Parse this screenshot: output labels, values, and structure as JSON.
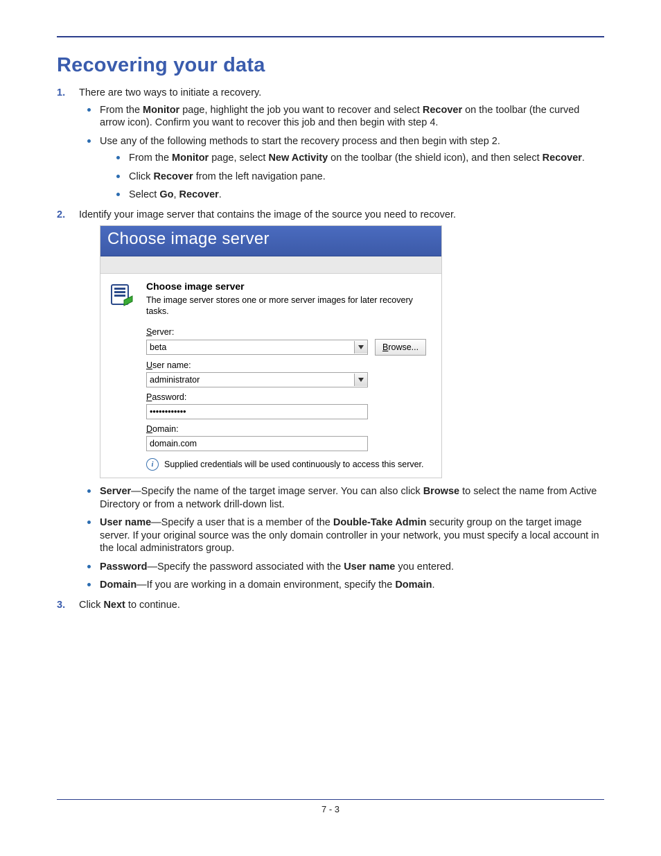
{
  "heading": "Recovering your data",
  "steps": {
    "s1": {
      "text": "There are two ways to initiate a recovery.",
      "bullets": {
        "b1": {
          "pre": "From the ",
          "bold1": "Monitor",
          "mid": " page, highlight the job you want to recover and select ",
          "bold2": "Recover",
          "post": " on the toolbar (the curved arrow icon). Confirm you want to recover this job and then begin with step 4."
        },
        "b2": {
          "text": "Use any of the following methods to start the recovery process and then begin with step 2.",
          "sub": {
            "s1": {
              "pre": "From the ",
              "bold1": "Monitor",
              "mid": " page, select ",
              "bold2": "New Activity",
              "mid2": " on the toolbar (the shield icon), and then select ",
              "bold3": "Recover",
              "post": "."
            },
            "s2": {
              "pre": "Click ",
              "bold1": "Recover",
              "post": " from the left navigation pane."
            },
            "s3": {
              "pre": "Select ",
              "bold1": "Go",
              "mid": ", ",
              "bold2": "Recover",
              "post": "."
            }
          }
        }
      }
    },
    "s2": {
      "text": "Identify your image server that contains the image of the source you need to recover."
    },
    "s3": {
      "pre": "Click ",
      "bold1": "Next",
      "post": " to continue."
    }
  },
  "dialog": {
    "title": "Choose image server",
    "header": "Choose image server",
    "subtitle": "The image server stores one or more server images for later recovery tasks.",
    "labels": {
      "server": "Server:",
      "user": "User name:",
      "pass": "Password:",
      "domain": "Domain:"
    },
    "underline": {
      "server": "S",
      "user": "U",
      "pass": "P",
      "domain": "D",
      "browse": "B"
    },
    "values": {
      "server": "beta",
      "user": "administrator",
      "pass": "••••••••••••",
      "domain": "domain.com"
    },
    "browse": "rowse...",
    "info": "Supplied credentials will be used continuously to access this server."
  },
  "fields": {
    "server": {
      "bold": "Server",
      "text": "—Specify the name of the target image server. You can also click ",
      "bold2": "Browse",
      "text2": " to select the name from Active Directory or from a network drill-down list."
    },
    "user": {
      "bold": "User name",
      "text": "—Specify a user that is a member of the ",
      "bold2": "Double-Take Admin",
      "text2": " security group on the target image server. If your original source was the only domain controller in your network, you must specify a local account in the local administrators group."
    },
    "pass": {
      "bold": "Password",
      "text": "—Specify the password associated with the ",
      "bold2": "User name",
      "text2": " you entered."
    },
    "domain": {
      "bold": "Domain",
      "text": "—If you are working in a domain environment, specify the ",
      "bold2": "Domain",
      "text2": "."
    }
  },
  "footer": "7 - 3"
}
